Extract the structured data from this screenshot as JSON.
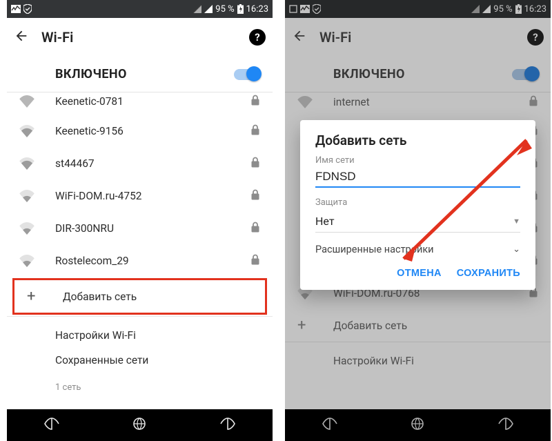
{
  "status": {
    "battery": "95 %",
    "time": "16:23"
  },
  "left": {
    "screen_title": "Wi-Fi",
    "enabled_label": "ВКЛЮЧЕНО",
    "networks": [
      {
        "ssid": "Keenetic-0781",
        "locked": true
      },
      {
        "ssid": "Keenetic-9156",
        "locked": true
      },
      {
        "ssid": "st44467",
        "locked": true
      },
      {
        "ssid": "WiFi-DOM.ru-4752",
        "locked": true
      },
      {
        "ssid": "DIR-300NRU",
        "locked": true
      },
      {
        "ssid": "Rostelecom_29",
        "locked": true
      }
    ],
    "add_network_label": "Добавить сеть",
    "settings_label": "Настройки Wi-Fi",
    "saved_label": "Сохраненные сети",
    "saved_count": "1 сеть"
  },
  "right": {
    "screen_title": "Wi-Fi",
    "enabled_label": "ВКЛЮЧЕНО",
    "bg_networks": [
      {
        "ssid": "internet",
        "locked": true
      },
      {
        "ssid": "",
        "locked": true
      },
      {
        "ssid": "",
        "locked": true
      },
      {
        "ssid": "",
        "locked": true
      },
      {
        "ssid": "",
        "locked": true
      },
      {
        "ssid": "",
        "locked": true
      },
      {
        "ssid": "WiFi-DOM.ru-0768",
        "locked": true
      }
    ],
    "bg_add_label": "Добавить сеть",
    "bg_footer": "Настройки Wi-Fi",
    "dialog": {
      "title": "Добавить сеть",
      "name_label": "Имя сети",
      "name_value": "FDNSD",
      "security_label": "Защита",
      "security_value": "Нет",
      "advanced_label": "Расширенные настройки",
      "cancel": "ОТМЕНА",
      "save": "СОХРАНИТЬ"
    }
  }
}
